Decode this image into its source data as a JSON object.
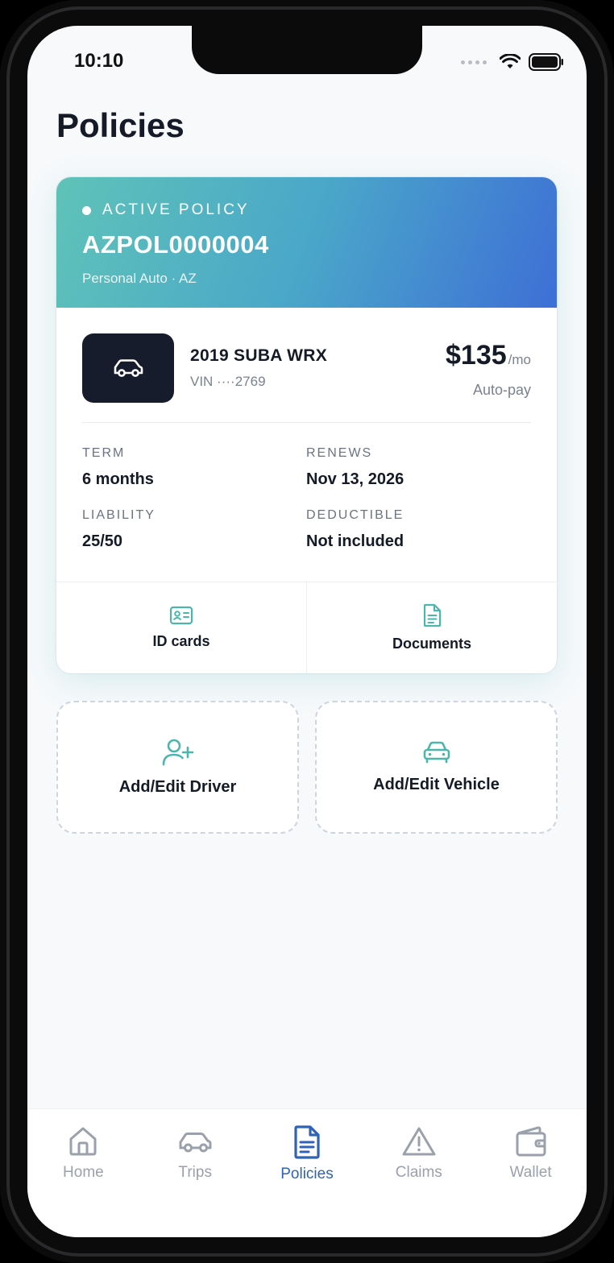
{
  "status_bar": {
    "time": "10:10"
  },
  "page": {
    "title": "Policies"
  },
  "policy": {
    "status_label": "ACTIVE POLICY",
    "number": "AZPOL0000004",
    "subtitle": "Personal Auto · AZ",
    "vehicle": {
      "name": "2019 SUBA WRX",
      "vin": "VIN ····2769",
      "icon": "car-icon"
    },
    "price": {
      "amount": "$135",
      "unit": "/mo",
      "payment": "Auto-pay"
    },
    "details": {
      "term": {
        "label": "TERM",
        "value": "6 months"
      },
      "renews": {
        "label": "RENEWS",
        "value": "Nov 13, 2026"
      },
      "liability": {
        "label": "LIABILITY",
        "value": "25/50"
      },
      "deductible": {
        "label": "DEDUCTIBLE",
        "value": "Not included"
      }
    },
    "actions": [
      {
        "label": "ID cards",
        "icon": "id-card-icon"
      },
      {
        "label": "Documents",
        "icon": "document-icon"
      }
    ]
  },
  "quick_actions": [
    {
      "label": "Add/Edit Driver",
      "icon": "add-user-icon"
    },
    {
      "label": "Add/Edit Vehicle",
      "icon": "car-front-icon"
    }
  ],
  "tabbar": {
    "items": [
      {
        "label": "Home",
        "icon": "home-icon",
        "active": false
      },
      {
        "label": "Trips",
        "icon": "car-icon",
        "active": false
      },
      {
        "label": "Policies",
        "icon": "document-icon",
        "active": true
      },
      {
        "label": "Claims",
        "icon": "warning-icon",
        "active": false
      },
      {
        "label": "Wallet",
        "icon": "wallet-icon",
        "active": false
      }
    ]
  },
  "colors": {
    "accent_teal": "#4cb6ad",
    "active_tab": "#2f63b8",
    "inactive_tab": "#9aa1ac",
    "text_dark": "#141a26"
  }
}
